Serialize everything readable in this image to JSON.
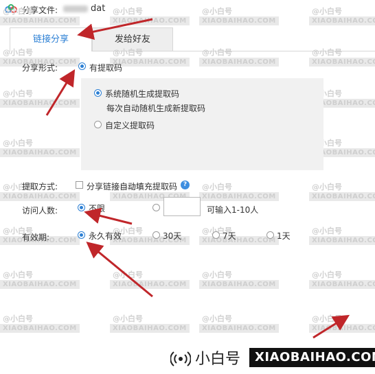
{
  "header": {
    "share_file_label": "分享文件:",
    "file_name": "dat"
  },
  "tabs": [
    {
      "label": "链接分享",
      "active": true
    },
    {
      "label": "发给好友",
      "active": false
    }
  ],
  "share_form": {
    "label": "分享形式:",
    "option": "有提取码",
    "sub_options": [
      {
        "label": "系统随机生成提取码",
        "note": "每次自动随机生成新提取码",
        "selected": true
      },
      {
        "label": "自定义提取码",
        "selected": false
      }
    ]
  },
  "extract_method": {
    "label": "提取方式:",
    "checkbox_label": "分享链接自动填充提取码",
    "checked": false,
    "help_icon": "?"
  },
  "visitors": {
    "label": "访问人数:",
    "options": [
      {
        "label": "不限",
        "selected": true
      },
      {
        "label": "",
        "selected": false
      }
    ],
    "count_value": "",
    "hint": "可输入1-10人"
  },
  "validity": {
    "label": "有效期:",
    "options": [
      {
        "label": "永久有效",
        "selected": true
      },
      {
        "label": "30天",
        "selected": false
      },
      {
        "label": "7天",
        "selected": false
      },
      {
        "label": "1天",
        "selected": false
      }
    ]
  },
  "watermark": {
    "brand": "@小白号",
    "domain": "XIAOBAIHAO.COM"
  },
  "footer_brand": {
    "name": "小白号",
    "url": "XIAOBAIHAO.COM"
  },
  "colors": {
    "accent": "#2b7fd4",
    "arrow": "#c0262a"
  }
}
